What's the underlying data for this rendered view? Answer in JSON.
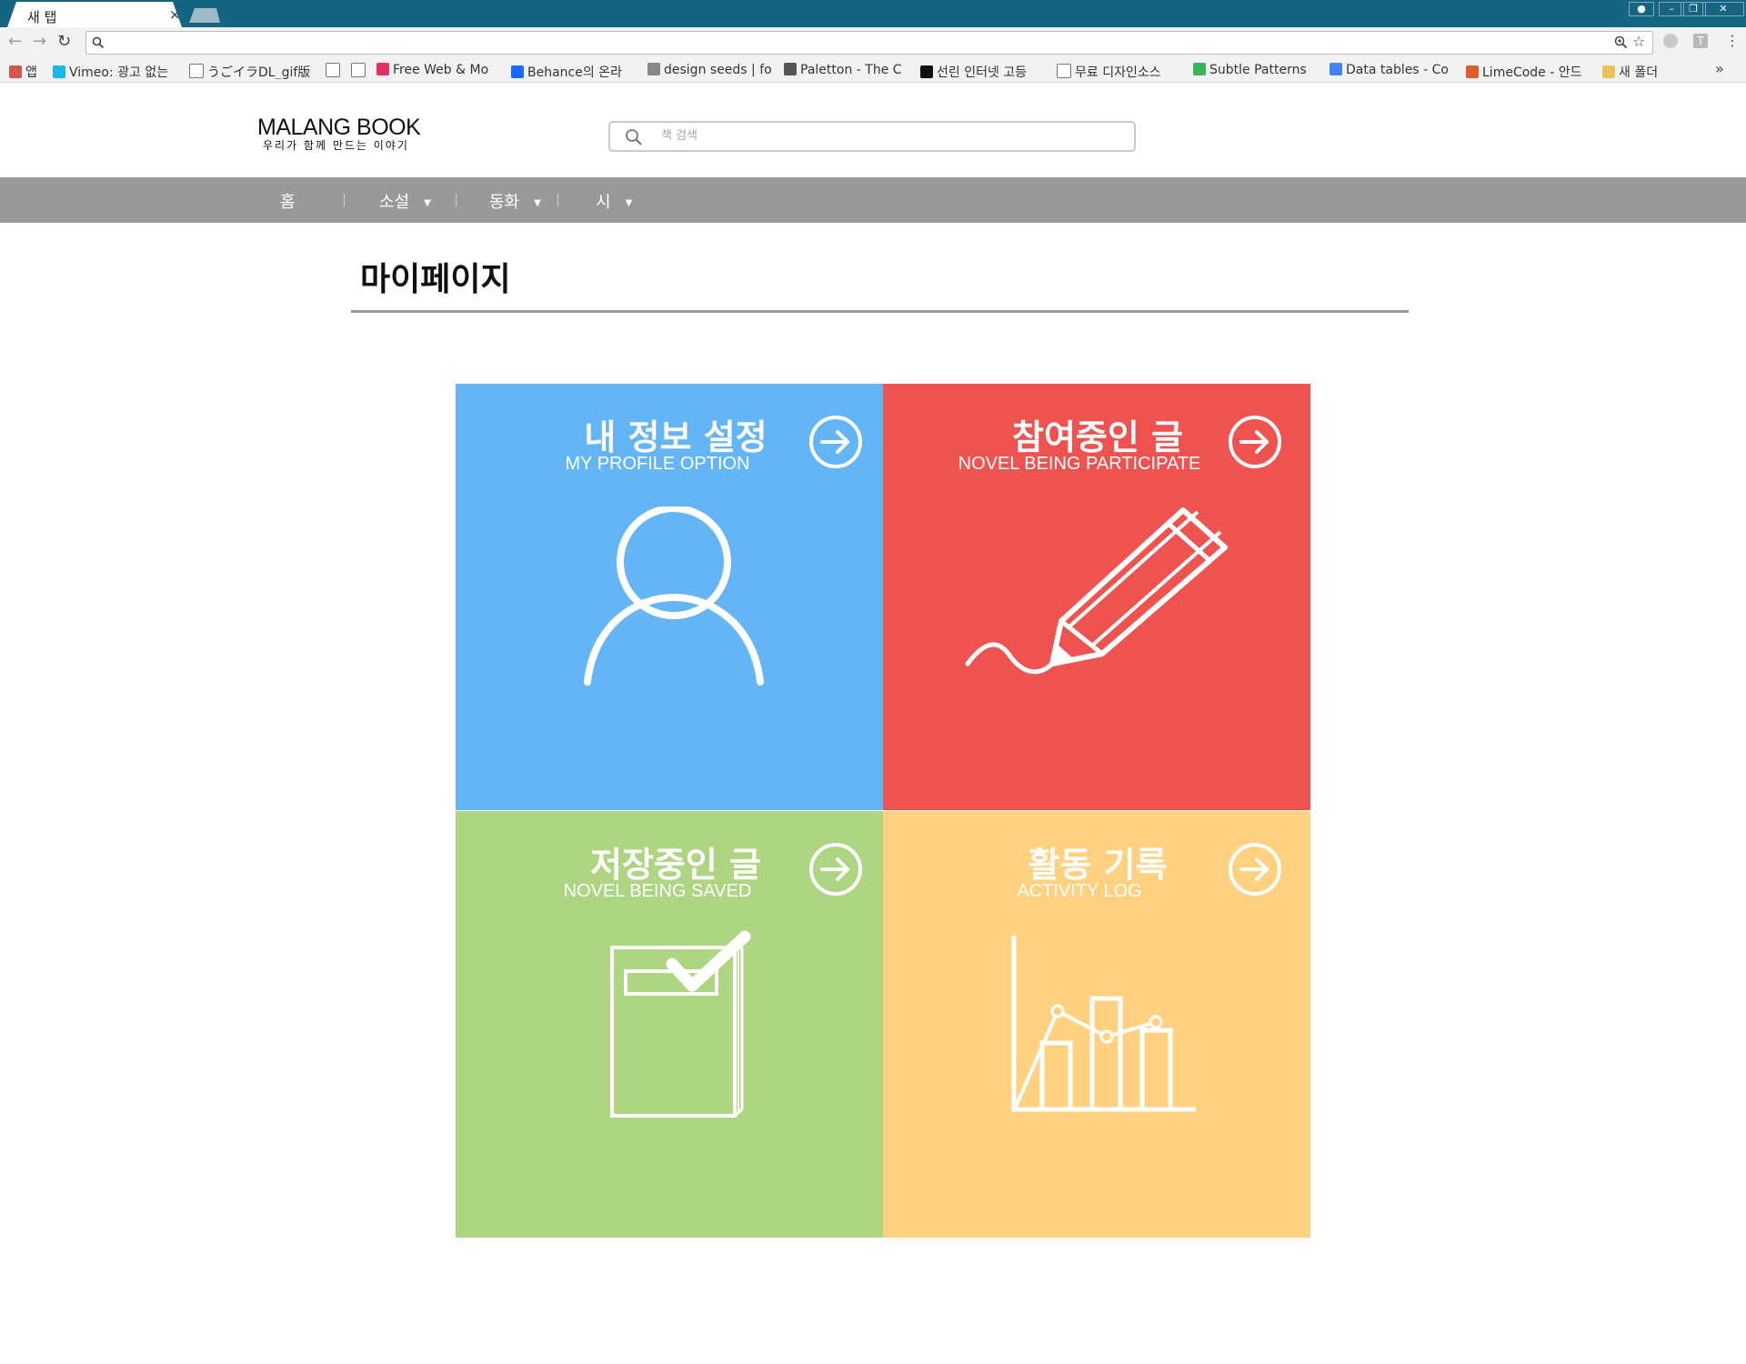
{
  "browser": {
    "tab_title": "새 탭",
    "tab_close": "×",
    "bookmarks": [
      {
        "label": "앱",
        "icon": "apps-grid-icon",
        "color": "#d9534f"
      },
      {
        "label": "Vimeo: 광고 없는",
        "icon": "vimeo-icon",
        "color": "#1ab7ea"
      },
      {
        "label": "うごイラDL_gif版",
        "icon": "page-icon",
        "color": "#ffffff"
      },
      {
        "label": "",
        "icon": "page-icon",
        "color": "#ffffff"
      },
      {
        "label": "",
        "icon": "page-icon",
        "color": "#ffffff"
      },
      {
        "label": "Free Web & Mo",
        "icon": "invision-icon",
        "color": "#e23264"
      },
      {
        "label": "Behance의 온라",
        "icon": "behance-icon",
        "color": "#1769ff"
      },
      {
        "label": "design seeds | fo",
        "icon": "design-seeds-icon",
        "color": "#888888"
      },
      {
        "label": "Paletton - The C",
        "icon": "paletton-icon",
        "color": "#555555"
      },
      {
        "label": "선린 인터넷 고등",
        "icon": "triangle-icon",
        "color": "#111111"
      },
      {
        "label": "무료 디자인소스",
        "icon": "page-icon",
        "color": "#ffffff"
      },
      {
        "label": "Subtle Patterns",
        "icon": "subtle-patterns-icon",
        "color": "#3cb35a"
      },
      {
        "label": "Data tables - Co",
        "icon": "google-icon",
        "color": "#4285f4"
      },
      {
        "label": "LimeCode - 안드",
        "icon": "limecode-icon",
        "color": "#e05a2b"
      },
      {
        "label": "새 폴더",
        "icon": "folder-icon",
        "color": "#e8c25a"
      }
    ],
    "overflow": "»"
  },
  "site": {
    "logo_title": "MALANG BOOK",
    "logo_subtitle": "우리가 함께 만드는 이야기",
    "search_placeholder": "책 검색"
  },
  "nav": {
    "items": [
      {
        "label": "홈",
        "has_dropdown": false
      },
      {
        "label": "소설",
        "has_dropdown": true
      },
      {
        "label": "동화",
        "has_dropdown": true
      },
      {
        "label": "시",
        "has_dropdown": true
      }
    ],
    "caret": "▼"
  },
  "page": {
    "title": "마이페이지"
  },
  "tiles": [
    {
      "title": "내 정보 설정",
      "subtitle": "MY PROFILE OPTION",
      "icon": "user-profile-icon",
      "color": "#64b5f6"
    },
    {
      "title": "참여중인 글",
      "subtitle": "NOVEL BEING PARTICIPATE",
      "icon": "pencil-icon",
      "color": "#ef5350"
    },
    {
      "title": "저장중인 글",
      "subtitle": "NOVEL BEING SAVED",
      "icon": "saved-book-icon",
      "color": "#aed581"
    },
    {
      "title": "활동 기록",
      "subtitle": "ACTIVITY LOG",
      "icon": "activity-chart-icon",
      "color": "#ffd180"
    }
  ]
}
